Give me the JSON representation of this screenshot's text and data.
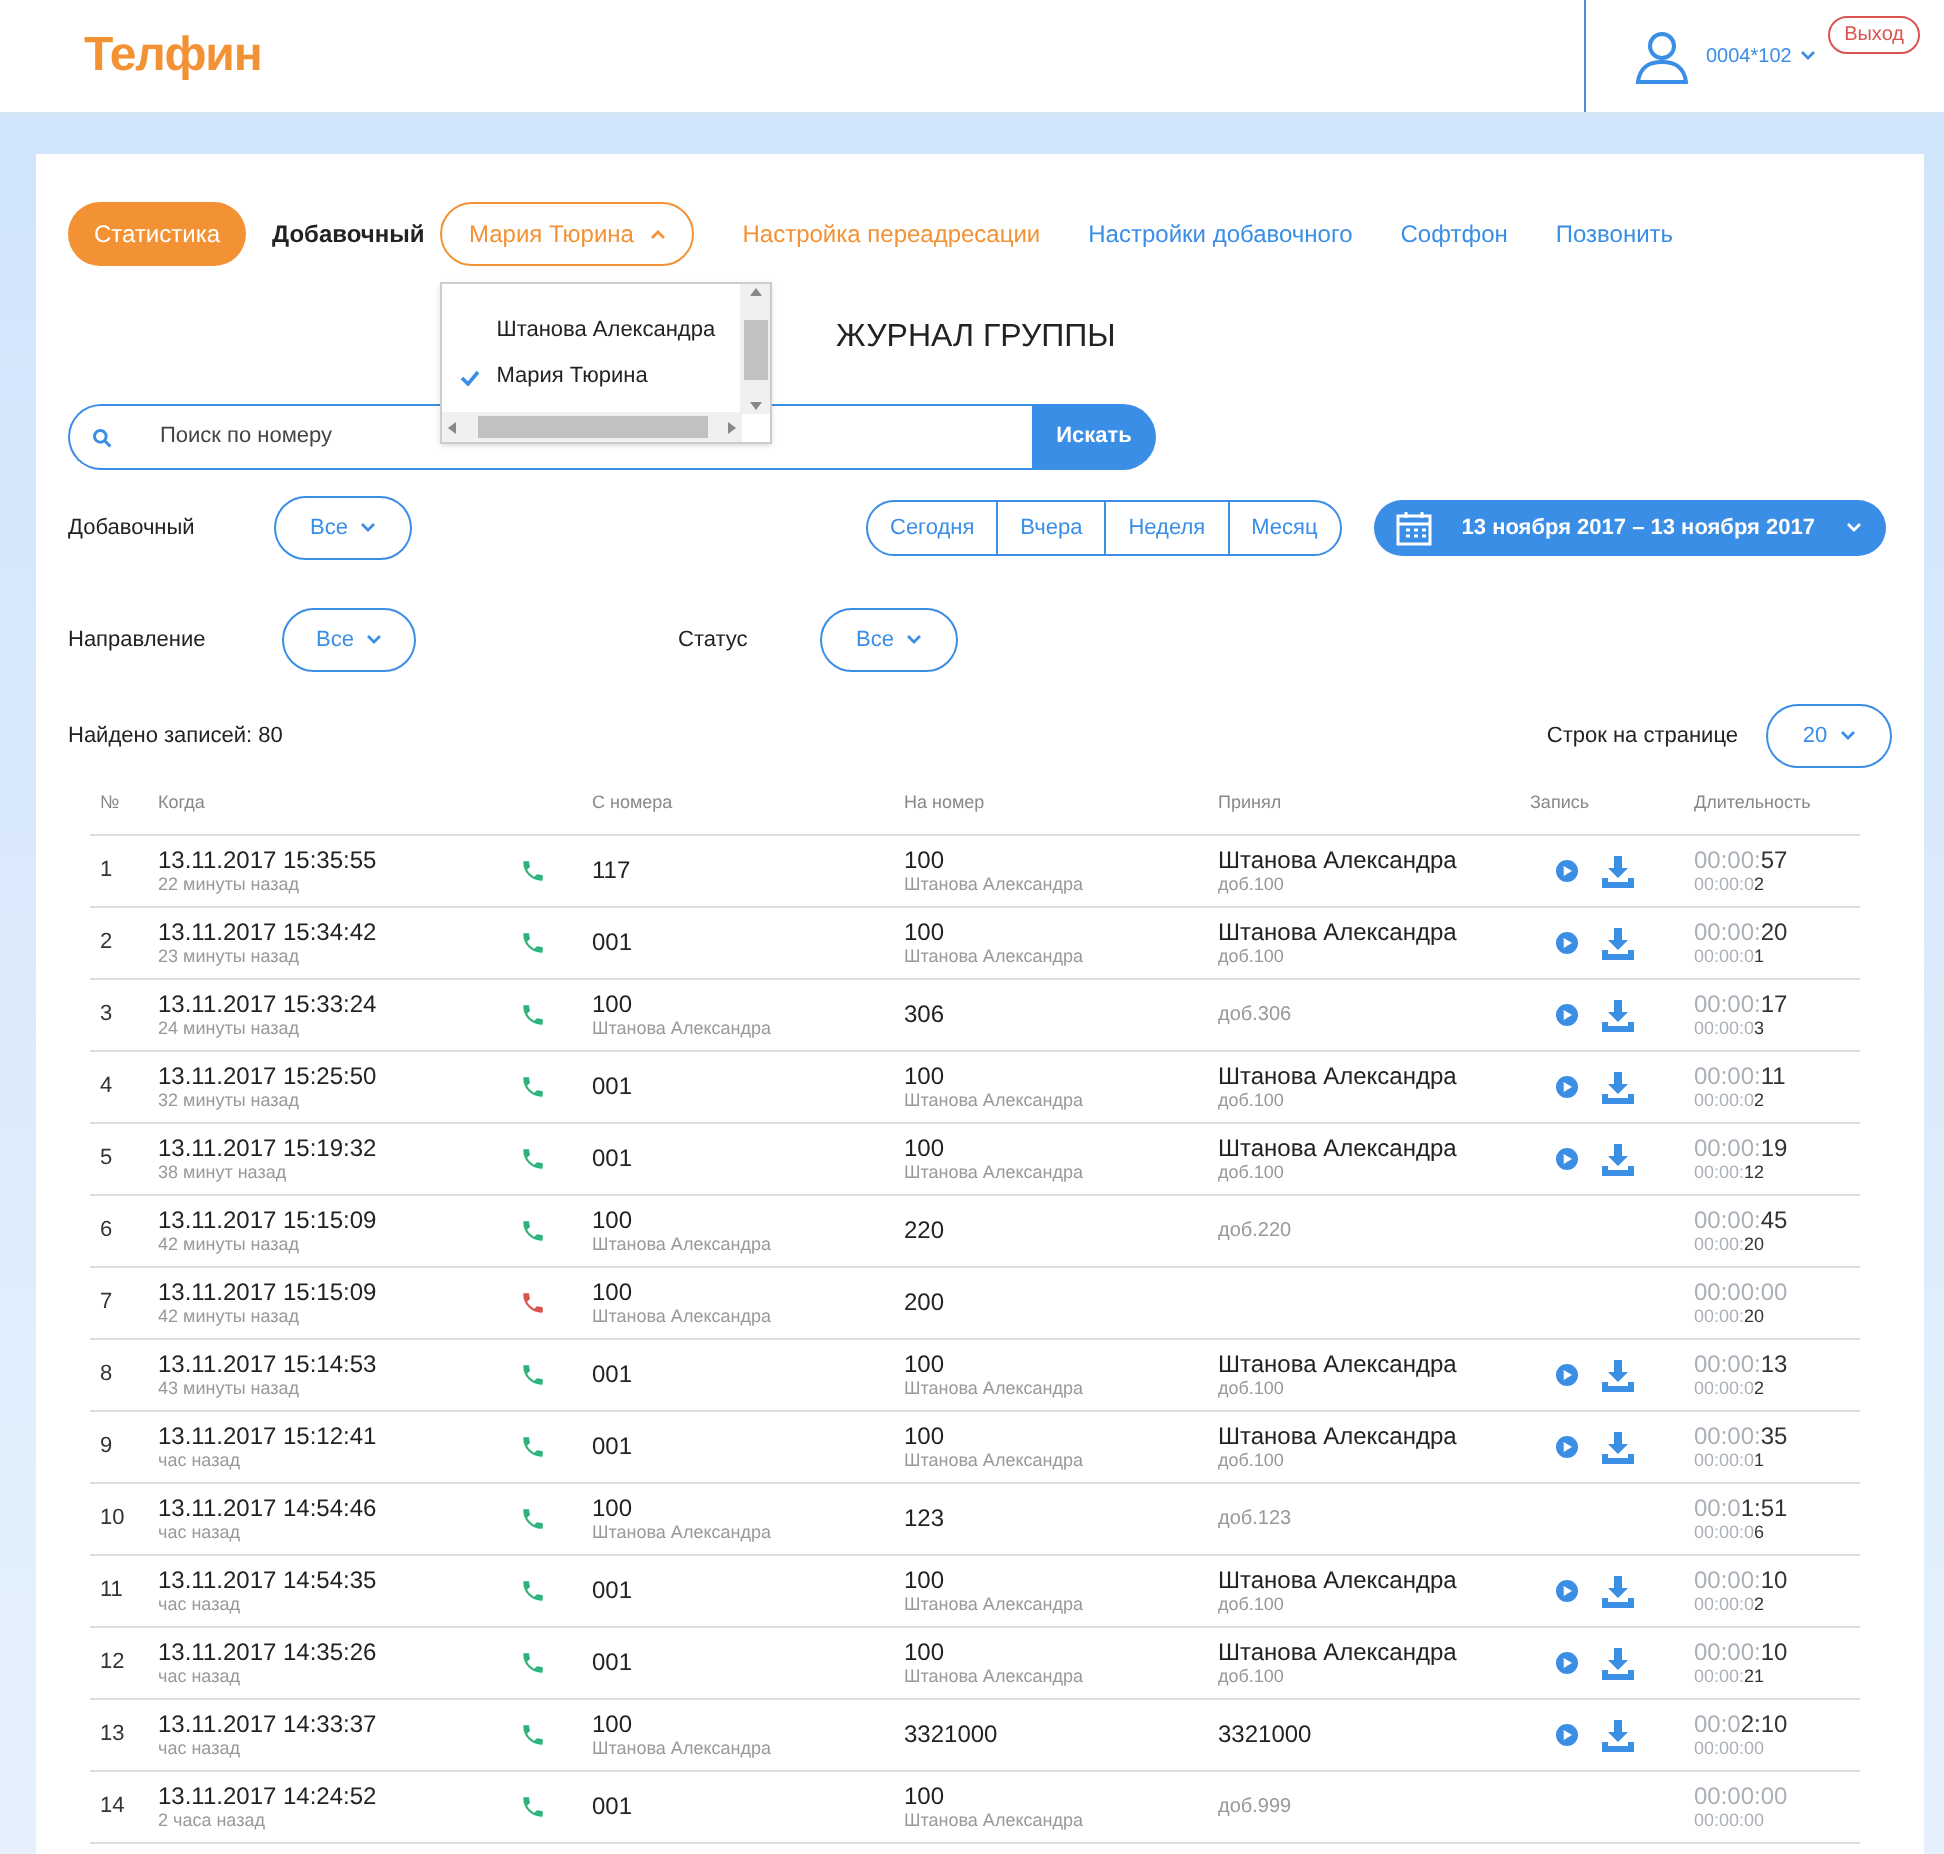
{
  "header": {
    "logo": "Телфин",
    "account": "0004*102",
    "logout": "Выход"
  },
  "nav": {
    "stats_button": "Статистика",
    "extension_label": "Добавочный",
    "extension_select": "Мария Тюрина",
    "links": [
      {
        "label": "Настройка переадресации",
        "kind": "accent"
      },
      {
        "label": "Настройки добавочного",
        "kind": "plain"
      },
      {
        "label": "Софтфон",
        "kind": "plain"
      },
      {
        "label": "Позвонить",
        "kind": "plain"
      }
    ]
  },
  "dropdown": {
    "expanded": true,
    "options": [
      {
        "label": "Штанова Александра",
        "selected": false
      },
      {
        "label": "Мария Тюрина",
        "selected": true
      }
    ]
  },
  "title": "ЖУРНАЛ ГРУППЫ",
  "search": {
    "placeholder": "Поиск по номеру",
    "button": "Искать"
  },
  "filters": {
    "extension": {
      "label": "Добавочный",
      "value": "Все"
    },
    "direction": {
      "label": "Направление",
      "value": "Все"
    },
    "status": {
      "label": "Статус",
      "value": "Все"
    },
    "periods": [
      {
        "label": "Сегодня",
        "selected": false
      },
      {
        "label": "Вчера",
        "selected": false
      },
      {
        "label": "Неделя",
        "selected": false
      },
      {
        "label": "Месяц",
        "selected": false
      }
    ],
    "date_range": "13 ноября 2017 – 13 ноября 2017"
  },
  "found": "Найдено записей: 80",
  "per_page_label": "Строк на странице",
  "per_page": "20",
  "table": {
    "columns": [
      "№",
      "Когда",
      "С номера",
      "На номер",
      "Принял",
      "Запись",
      "Длительность"
    ],
    "rows": [
      {
        "n": "1",
        "when": "13.11.2017 15:35:55",
        "ago": "22 минуты назад",
        "missed": false,
        "from": "117",
        "to": "100",
        "to_name": "Штанова Александра",
        "taken": "Штанова Александра",
        "taken_ext": "доб.100",
        "record": true,
        "duration": "00:00:57",
        "wait": "00:00:02"
      },
      {
        "n": "2",
        "when": "13.11.2017 15:34:42",
        "ago": "23 минуты назад",
        "missed": false,
        "from": "001",
        "to": "100",
        "to_name": "Штанова Александра",
        "taken": "Штанова Александра",
        "taken_ext": "доб.100",
        "record": true,
        "duration": "00:00:20",
        "wait": "00:00:01"
      },
      {
        "n": "3",
        "when": "13.11.2017 15:33:24",
        "ago": "24 минуты назад",
        "missed": false,
        "from": "100",
        "from_name": "Штанова Александра",
        "to": "306",
        "taken_ext": "доб.306",
        "record": true,
        "duration": "00:00:17",
        "wait": "00:00:03"
      },
      {
        "n": "4",
        "when": "13.11.2017 15:25:50",
        "ago": "32 минуты назад",
        "missed": false,
        "from": "001",
        "to": "100",
        "to_name": "Штанова Александра",
        "taken": "Штанова Александра",
        "taken_ext": "доб.100",
        "record": true,
        "duration": "00:00:11",
        "wait": "00:00:02"
      },
      {
        "n": "5",
        "when": "13.11.2017 15:19:32",
        "ago": "38 минут назад",
        "missed": false,
        "from": "001",
        "to": "100",
        "to_name": "Штанова Александра",
        "taken": "Штанова Александра",
        "taken_ext": "доб.100",
        "record": true,
        "duration": "00:00:19",
        "wait": "00:00:12"
      },
      {
        "n": "6",
        "when": "13.11.2017 15:15:09",
        "ago": "42 минуты назад",
        "missed": false,
        "from": "100",
        "from_name": "Штанова Александра",
        "to": "220",
        "taken_ext": "доб.220",
        "record": false,
        "duration": "00:00:45",
        "wait": "00:00:20"
      },
      {
        "n": "7",
        "when": "13.11.2017 15:15:09",
        "ago": "42 минуты назад",
        "missed": true,
        "from": "100",
        "from_name": "Штанова Александра",
        "to": "200",
        "record": false,
        "duration": "00:00:00",
        "wait": "00:00:20"
      },
      {
        "n": "8",
        "when": "13.11.2017 15:14:53",
        "ago": "43 минуты назад",
        "missed": false,
        "from": "001",
        "to": "100",
        "to_name": "Штанова Александра",
        "taken": "Штанова Александра",
        "taken_ext": "доб.100",
        "record": true,
        "duration": "00:00:13",
        "wait": "00:00:02"
      },
      {
        "n": "9",
        "when": "13.11.2017 15:12:41",
        "ago": "час назад",
        "missed": false,
        "from": "001",
        "to": "100",
        "to_name": "Штанова Александра",
        "taken": "Штанова Александра",
        "taken_ext": "доб.100",
        "record": true,
        "duration": "00:00:35",
        "wait": "00:00:01"
      },
      {
        "n": "10",
        "when": "13.11.2017 14:54:46",
        "ago": "час назад",
        "missed": false,
        "from": "100",
        "from_name": "Штанова Александра",
        "to": "123",
        "taken_ext": "доб.123",
        "record": false,
        "duration": "00:01:51",
        "wait": "00:00:06"
      },
      {
        "n": "11",
        "when": "13.11.2017 14:54:35",
        "ago": "час назад",
        "missed": false,
        "from": "001",
        "to": "100",
        "to_name": "Штанова Александра",
        "taken": "Штанова Александра",
        "taken_ext": "доб.100",
        "record": true,
        "duration": "00:00:10",
        "wait": "00:00:02"
      },
      {
        "n": "12",
        "when": "13.11.2017 14:35:26",
        "ago": "час назад",
        "missed": false,
        "from": "001",
        "to": "100",
        "to_name": "Штанова Александра",
        "taken": "Штанова Александра",
        "taken_ext": "доб.100",
        "record": true,
        "duration": "00:00:10",
        "wait": "00:00:21"
      },
      {
        "n": "13",
        "when": "13.11.2017 14:33:37",
        "ago": "час назад",
        "missed": false,
        "from": "100",
        "from_name": "Штанова Александра",
        "to": "3321000",
        "taken": "3321000",
        "record": true,
        "duration": "00:02:10",
        "wait": "00:00:00"
      },
      {
        "n": "14",
        "when": "13.11.2017 14:24:52",
        "ago": "2 часа назад",
        "missed": false,
        "from": "001",
        "to": "100",
        "to_name": "Штанова Александра",
        "taken_ext": "доб.999",
        "record": false,
        "duration": "00:00:00",
        "wait": "00:00:00"
      }
    ]
  }
}
